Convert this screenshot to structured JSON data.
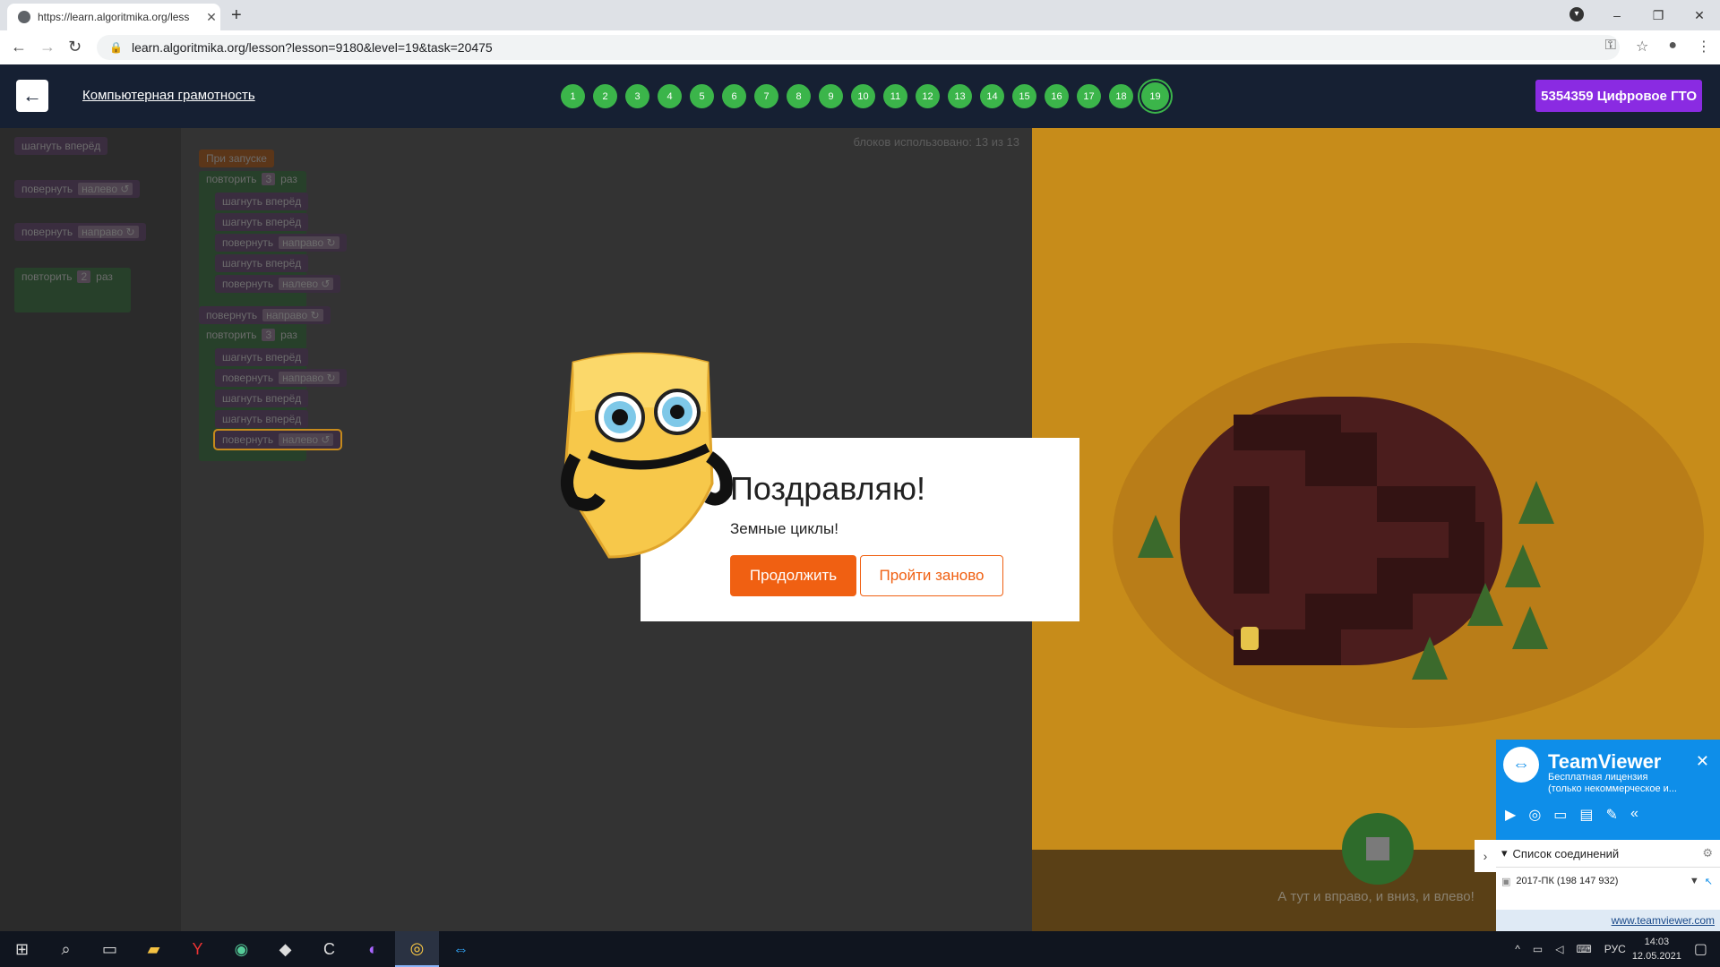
{
  "browser": {
    "tab_title": "https://learn.algoritmika.org/less",
    "url": "learn.algoritmika.org/lesson?lesson=9180&level=19&task=20475",
    "new_tab": "+",
    "minimize": "–",
    "restore": "❐",
    "close": "✕"
  },
  "header": {
    "back": "←",
    "course_title": "Компьютерная грамотность",
    "levels": [
      "1",
      "2",
      "3",
      "4",
      "5",
      "6",
      "7",
      "8",
      "9",
      "10",
      "11",
      "12",
      "13",
      "14",
      "15",
      "16",
      "17",
      "18",
      "19"
    ],
    "current_level": "19",
    "gto_button": "5354359 Цифровое ГТО"
  },
  "toolbox": {
    "blocks": [
      "шагнуть вперёд",
      "повернуть",
      "налево ↺",
      "повернуть",
      "направо ↻",
      "повторить",
      "2",
      "раз"
    ]
  },
  "workspace": {
    "block_count": "блоков использовано: 13 из 13",
    "start": "При запуске",
    "repeat": "повторить",
    "times": "раз",
    "n3": "3",
    "step": "шагнуть вперёд",
    "turn": "повернуть",
    "right": "направо ↻",
    "left": "налево ↺"
  },
  "dialog": {
    "title": "Поздравляю!",
    "subtitle": "Земные циклы!",
    "continue": "Продолжить",
    "retry": "Пройти заново"
  },
  "game": {
    "hint": "А тут и вправо, и вниз, и влево!"
  },
  "teamviewer": {
    "name": "TeamViewer",
    "license_line1": "Бесплатная лицензия",
    "license_line2": "(только некоммерческое и...",
    "close": "✕",
    "connections": "Список соединений",
    "item": "2017-ПК (198 147 932)",
    "link": "www.teamviewer.com"
  },
  "taskbar": {
    "lang": "РУС",
    "time": "14:03",
    "date": "12.05.2021"
  }
}
